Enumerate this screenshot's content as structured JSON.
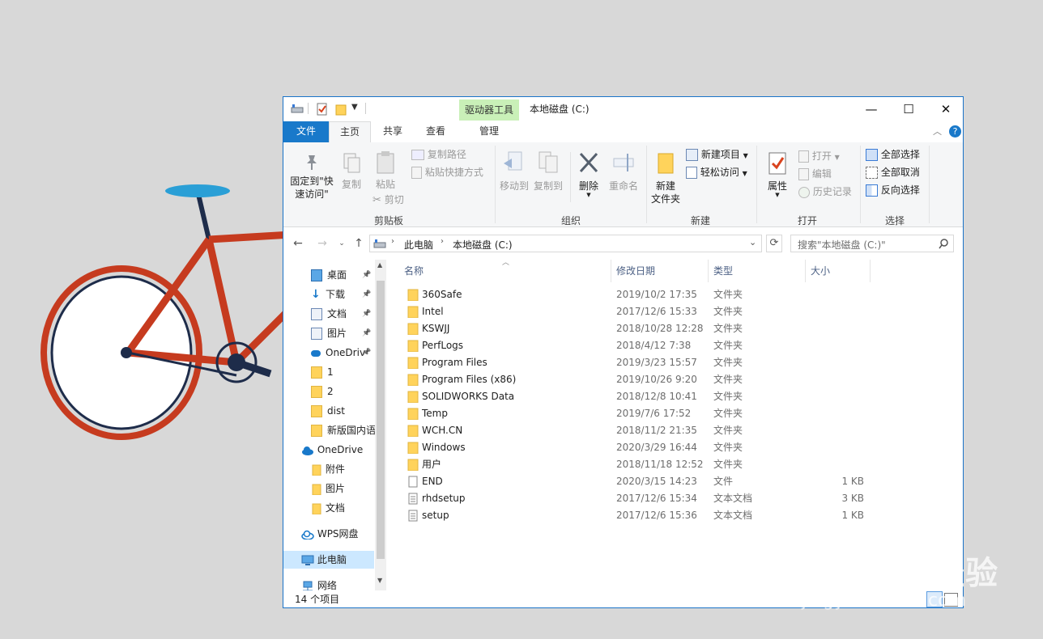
{
  "window": {
    "title": "本地磁盘 (C:)",
    "context_tab": "驱动器工具",
    "controls": {
      "minimize": "—",
      "maximize": "☐",
      "close": "✕"
    }
  },
  "tabs": {
    "file": "文件",
    "home": "主页",
    "share": "共享",
    "view": "查看",
    "manage": "管理"
  },
  "ribbon": {
    "clipboard": {
      "label": "剪贴板",
      "pin": "固定到\"快\n速访问\"",
      "copy": "复制",
      "paste": "粘贴",
      "copy_path": "复制路径",
      "paste_shortcut": "粘贴快捷方式",
      "cut": "剪切"
    },
    "organize": {
      "label": "组织",
      "move_to": "移动到",
      "copy_to": "复制到",
      "delete": "删除",
      "rename": "重命名"
    },
    "new": {
      "label": "新建",
      "new_folder": "新建\n文件夹",
      "new_item": "新建项目",
      "easy_access": "轻松访问"
    },
    "open": {
      "label": "打开",
      "properties": "属性",
      "open": "打开",
      "edit": "编辑",
      "history": "历史记录"
    },
    "select": {
      "label": "选择",
      "select_all": "全部选择",
      "select_none": "全部取消",
      "invert": "反向选择"
    }
  },
  "address": {
    "crumbs": [
      "此电脑",
      "本地磁盘 (C:)"
    ],
    "search_placeholder": "搜索\"本地磁盘 (C:)\""
  },
  "nav_pane": {
    "quick_access": [
      {
        "label": "桌面",
        "icon": "desktop-icon",
        "pinned": true
      },
      {
        "label": "下载",
        "icon": "download-icon",
        "pinned": true
      },
      {
        "label": "文档",
        "icon": "document-icon",
        "pinned": true
      },
      {
        "label": "图片",
        "icon": "picture-icon",
        "pinned": true
      },
      {
        "label": "OneDriv",
        "icon": "cloud-icon",
        "pinned": true
      },
      {
        "label": "1",
        "icon": "folder-icon",
        "pinned": false
      },
      {
        "label": "2",
        "icon": "folder-icon",
        "pinned": false
      },
      {
        "label": "dist",
        "icon": "folder-icon",
        "pinned": false
      },
      {
        "label": "新版国内语",
        "icon": "folder-icon",
        "pinned": false
      }
    ],
    "onedrive": {
      "label": "OneDrive",
      "children": [
        "附件",
        "图片",
        "文档"
      ]
    },
    "wps": "WPS网盘",
    "this_pc": "此电脑",
    "network": "网络"
  },
  "file_list": {
    "columns": {
      "name": "名称",
      "modified": "修改日期",
      "type": "类型",
      "size": "大小"
    },
    "items": [
      {
        "name": "360Safe",
        "modified": "2019/10/2 17:35",
        "type": "文件夹",
        "size": "",
        "kind": "folder"
      },
      {
        "name": "Intel",
        "modified": "2017/12/6 15:33",
        "type": "文件夹",
        "size": "",
        "kind": "folder"
      },
      {
        "name": "KSWJJ",
        "modified": "2018/10/28 12:28",
        "type": "文件夹",
        "size": "",
        "kind": "folder"
      },
      {
        "name": "PerfLogs",
        "modified": "2018/4/12 7:38",
        "type": "文件夹",
        "size": "",
        "kind": "folder"
      },
      {
        "name": "Program Files",
        "modified": "2019/3/23 15:57",
        "type": "文件夹",
        "size": "",
        "kind": "folder"
      },
      {
        "name": "Program Files (x86)",
        "modified": "2019/10/26 9:20",
        "type": "文件夹",
        "size": "",
        "kind": "folder"
      },
      {
        "name": "SOLIDWORKS Data",
        "modified": "2018/12/8 10:41",
        "type": "文件夹",
        "size": "",
        "kind": "folder"
      },
      {
        "name": "Temp",
        "modified": "2019/7/6 17:52",
        "type": "文件夹",
        "size": "",
        "kind": "folder"
      },
      {
        "name": "WCH.CN",
        "modified": "2018/11/2 21:35",
        "type": "文件夹",
        "size": "",
        "kind": "folder"
      },
      {
        "name": "Windows",
        "modified": "2020/3/29 16:44",
        "type": "文件夹",
        "size": "",
        "kind": "folder"
      },
      {
        "name": "用户",
        "modified": "2018/11/18 12:52",
        "type": "文件夹",
        "size": "",
        "kind": "folder"
      },
      {
        "name": "END",
        "modified": "2020/3/15 14:23",
        "type": "文件",
        "size": "1 KB",
        "kind": "file"
      },
      {
        "name": "rhdsetup",
        "modified": "2017/12/6 15:34",
        "type": "文本文档",
        "size": "3 KB",
        "kind": "text"
      },
      {
        "name": "setup",
        "modified": "2017/12/6 15:36",
        "type": "文本文档",
        "size": "1 KB",
        "kind": "text"
      }
    ]
  },
  "status": {
    "count": "14 个项目"
  },
  "watermark": {
    "brand": "Bai du 经验",
    "url": "jingyan.baidu.com"
  },
  "colors": {
    "accent": "#1979ca",
    "context_tab": "#c9f0b8",
    "folder": "#ffd35b",
    "bike_frame": "#c63b1f",
    "seat": "#2a9fd6"
  }
}
